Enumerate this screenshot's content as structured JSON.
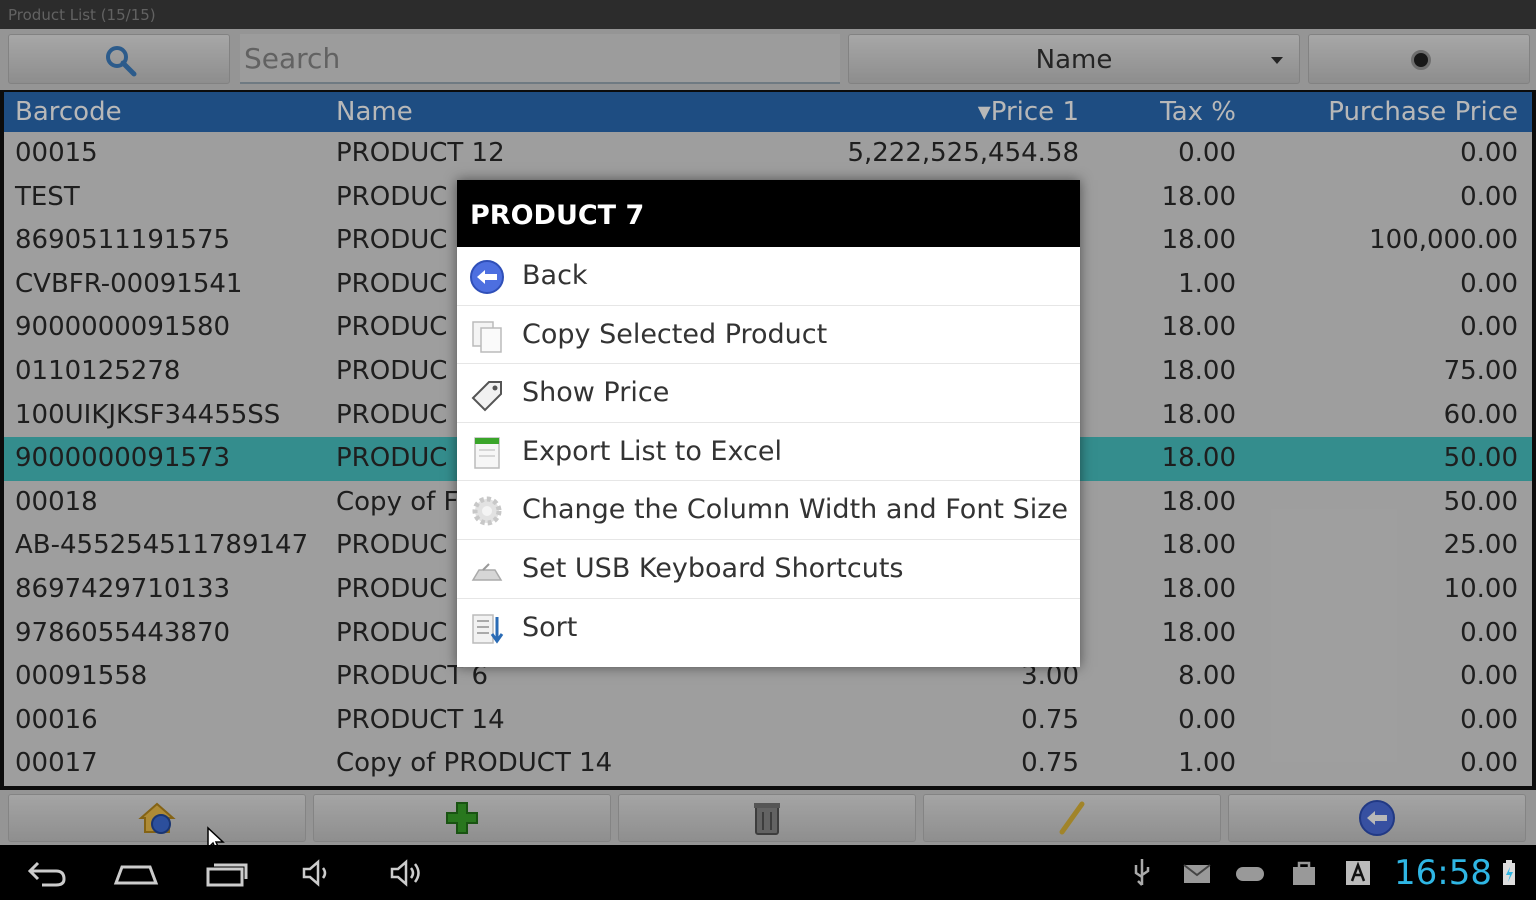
{
  "window": {
    "title": "Product List (15/15)"
  },
  "search": {
    "placeholder": "Search"
  },
  "sort_select": {
    "selected": "Name"
  },
  "table": {
    "columns": [
      "Barcode",
      "Name",
      "▾Price 1",
      "Tax %",
      "Purchase Price"
    ],
    "rows": [
      [
        "00015",
        "PRODUCT 12",
        "5,222,525,454.58",
        "0.00",
        "0.00"
      ],
      [
        "TEST",
        "PRODUC",
        "",
        "18.00",
        "0.00"
      ],
      [
        "8690511191575",
        "PRODUC",
        "",
        "18.00",
        "100,000.00"
      ],
      [
        "CVBFR-00091541",
        "PRODUC",
        "",
        "1.00",
        "0.00"
      ],
      [
        "9000000091580",
        "PRODUC",
        "",
        "18.00",
        "0.00"
      ],
      [
        "0110125278",
        "PRODUC",
        "",
        "18.00",
        "75.00"
      ],
      [
        "100UIKJKSF34455SS",
        "PRODUC",
        "",
        "18.00",
        "60.00"
      ],
      [
        "9000000091573",
        "PRODUC",
        "",
        "18.00",
        "50.00"
      ],
      [
        "00018",
        "Copy of F",
        "",
        "18.00",
        "50.00"
      ],
      [
        "AB-455254511789147",
        "PRODUC",
        "",
        "18.00",
        "25.00"
      ],
      [
        "8697429710133",
        "PRODUC",
        "",
        "18.00",
        "10.00"
      ],
      [
        "9786055443870",
        "PRODUC",
        "",
        "18.00",
        "0.00"
      ],
      [
        "00091558",
        "PRODUCT 6",
        "3.00",
        "8.00",
        "0.00"
      ],
      [
        "00016",
        "PRODUCT 14",
        "0.75",
        "0.00",
        "0.00"
      ],
      [
        "00017",
        "Copy of PRODUCT 14",
        "0.75",
        "1.00",
        "0.00"
      ]
    ],
    "selected_row": 7
  },
  "dialog": {
    "title": "PRODUCT 7",
    "items": [
      {
        "label": "Back",
        "icon": "back-arrow-icon"
      },
      {
        "label": "Copy Selected Product",
        "icon": "copy-icon"
      },
      {
        "label": "Show Price",
        "icon": "price-tag-icon"
      },
      {
        "label": "Export List to Excel",
        "icon": "excel-icon"
      },
      {
        "label": "Change the Column Width and Font Size",
        "icon": "gear-icon"
      },
      {
        "label": "Set USB Keyboard Shortcuts",
        "icon": "keyboard-icon"
      },
      {
        "label": "Sort",
        "icon": "sort-icon"
      }
    ]
  },
  "bottom_toolbar": {
    "buttons": [
      "home-icon",
      "add-icon",
      "delete-icon",
      "edit-icon",
      "back-icon"
    ]
  },
  "status_bar": {
    "time": "16:58"
  },
  "colors": {
    "header_blue": "#2a6bb5",
    "selected_row": "#48c4c4",
    "clock": "#2fb6e4",
    "add_green": "#3aa52a"
  }
}
